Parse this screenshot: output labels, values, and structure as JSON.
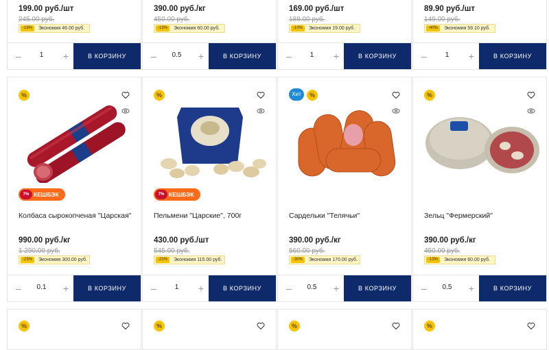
{
  "colors": {
    "button": "#0e2a6b",
    "badge_yellow": "#f8c300",
    "cashback": "#ff6b1a",
    "hit": "#1f8ad9"
  },
  "top_row": [
    {
      "price": "199.00 руб./шт",
      "old_price": "245.00 руб.",
      "discount": "-19%",
      "savings": "Экономия 46.00 руб.",
      "qty": "1",
      "button": "В КОРЗИНУ"
    },
    {
      "price": "390.00 руб./кг",
      "old_price": "450.00 руб.",
      "discount": "-13%",
      "savings": "Экономия 60.00 руб.",
      "qty": "0.5",
      "button": "В КОРЗИНУ"
    },
    {
      "price": "169.00 руб./шт",
      "old_price": "188.00 руб.",
      "discount": "-10%",
      "savings": "Экономия 19.00 руб.",
      "qty": "1",
      "button": "В КОРЗИНУ"
    },
    {
      "price": "89.90 руб./шт",
      "old_price": "149.00 руб.",
      "discount": "-40%",
      "savings": "Экономия 59.10 руб.",
      "qty": "1",
      "button": "В КОРЗИНУ"
    }
  ],
  "products": [
    {
      "badge": "%",
      "hit": "",
      "cashback": "КЕШБЭК",
      "cashback_pct": "7%",
      "title": "Колбаса сырокопченая \"Царская\"",
      "price": "990.00 руб./кг",
      "old_price": "1 290.00 руб.",
      "discount": "-23%",
      "savings": "Экономия 300.00 руб.",
      "qty": "0.1",
      "button": "В КОРЗИНУ",
      "image": "salami"
    },
    {
      "badge": "%",
      "hit": "",
      "cashback": "КЕШБЭК",
      "cashback_pct": "7%",
      "title": "Пельмени \"Царские\", 700г",
      "price": "430.00 руб./шт",
      "old_price": "545.00 руб.",
      "discount": "-21%",
      "savings": "Экономия 115.00 руб.",
      "qty": "1",
      "button": "В КОРЗИНУ",
      "image": "dumplings"
    },
    {
      "badge": "%",
      "hit": "Хит",
      "cashback": "",
      "cashback_pct": "",
      "title": "Сардельки \"Телячьи\"",
      "price": "390.00 руб./кг",
      "old_price": "560.00 руб.",
      "discount": "-30%",
      "savings": "Экономия 170.00 руб.",
      "qty": "0.5",
      "button": "В КОРЗИНУ",
      "image": "sausages"
    },
    {
      "badge": "%",
      "hit": "",
      "cashback": "",
      "cashback_pct": "",
      "title": "Зельц \"Фермерский\"",
      "price": "390.00 руб./кг",
      "old_price": "450.00 руб.",
      "discount": "-13%",
      "savings": "Экономия 60.00 руб.",
      "qty": "0.5",
      "button": "В КОРЗИНУ",
      "image": "brawn"
    }
  ],
  "bottom_row": [
    {
      "badge": "%"
    },
    {
      "badge": "%"
    },
    {
      "badge": "%"
    },
    {
      "badge": "%"
    }
  ],
  "icons": {
    "favorite": "heart-icon",
    "compare": "eye-icon",
    "minus": "minus-icon",
    "plus": "plus-icon"
  }
}
